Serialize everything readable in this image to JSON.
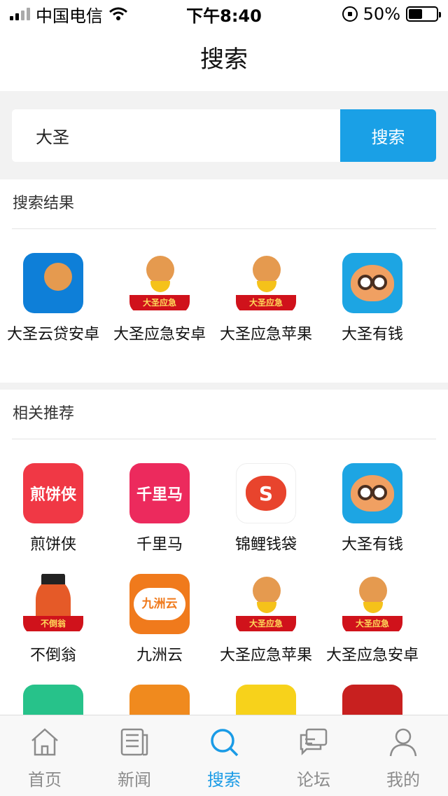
{
  "status_bar": {
    "carrier": "中国电信",
    "time": "下午8:40",
    "battery": "50%",
    "battery_level": 0.5
  },
  "nav": {
    "title": "搜索"
  },
  "search": {
    "value": "大圣",
    "button_label": "搜索"
  },
  "results": {
    "header": "搜索结果",
    "items": [
      {
        "name": "大圣云贷安卓",
        "icon": "yunda-icon"
      },
      {
        "name": "大圣应急安卓",
        "icon": "monkey-banner-icon",
        "banner": "大圣应急"
      },
      {
        "name": "大圣应急苹果",
        "icon": "monkey-banner-icon",
        "banner": "大圣应急"
      },
      {
        "name": "大圣有钱",
        "icon": "monkey-face-icon"
      }
    ]
  },
  "recommend": {
    "header": "相关推荐",
    "items": [
      {
        "name": "煎饼侠",
        "icon": "jianbing-icon",
        "icon_text": "煎饼侠"
      },
      {
        "name": "千里马",
        "icon": "horse-icon",
        "icon_text": "千里马"
      },
      {
        "name": "锦鲤钱袋",
        "icon": "money-bag-icon"
      },
      {
        "name": "大圣有钱",
        "icon": "monkey-face-icon"
      },
      {
        "name": "不倒翁",
        "icon": "tumbler-icon",
        "banner": "不倒翁"
      },
      {
        "name": "九洲云",
        "icon": "cloud-icon",
        "icon_text": "九洲云"
      },
      {
        "name": "大圣应急苹果",
        "icon": "monkey-banner-icon",
        "banner": "大圣应急"
      },
      {
        "name": "大圣应急安卓",
        "icon": "monkey-banner-icon",
        "banner": "大圣应急"
      }
    ]
  },
  "tabs": [
    {
      "label": "首页",
      "icon": "home-icon",
      "active": false
    },
    {
      "label": "新闻",
      "icon": "news-icon",
      "active": false
    },
    {
      "label": "搜索",
      "icon": "search-icon",
      "active": true
    },
    {
      "label": "论坛",
      "icon": "forum-icon",
      "active": false
    },
    {
      "label": "我的",
      "icon": "profile-icon",
      "active": false
    }
  ],
  "colors": {
    "accent": "#1aa0e6",
    "tab_active": "#1a9be6",
    "tab_inactive": "#8c8c8c"
  }
}
